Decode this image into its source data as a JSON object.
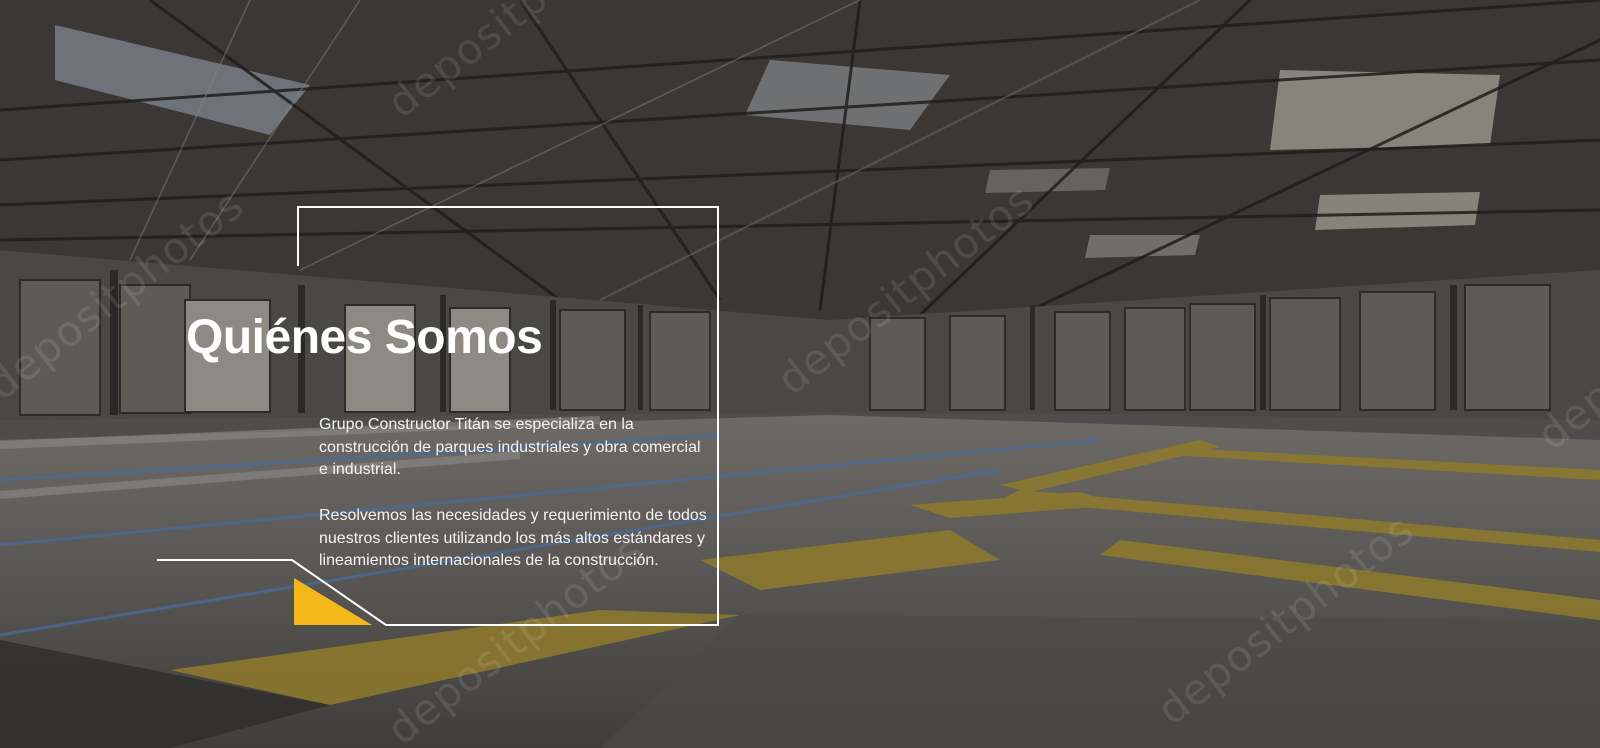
{
  "section": {
    "title": "Quiénes Somos",
    "paragraphs": [
      "Grupo Constructor Titán se especializa en la construcción de parques industriales y obra comercial e industrial.",
      "Resolvemos las necesidades y requerimiento de todos nuestros clientes utilizando los más altos estándares y lineamientos internacionales de la construcción."
    ]
  },
  "background": {
    "watermark_text": "depositphotos",
    "accent_color": "#f4b81a",
    "frame_color": "#ffffff"
  }
}
